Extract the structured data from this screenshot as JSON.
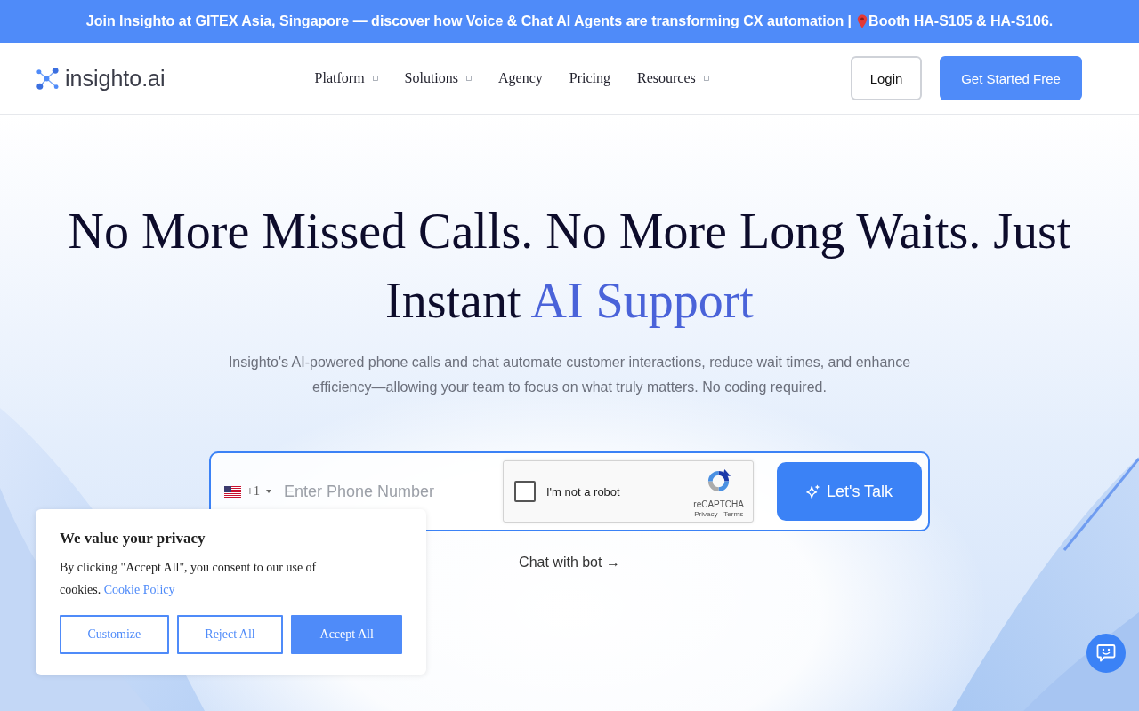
{
  "announcement_bar": {
    "text": "Join Insighto at GITEX Asia, Singapore — discover how Voice & Chat AI Agents are transforming CX automation |",
    "booth": "Booth HA-S105 & HA-S106."
  },
  "navbar": {
    "logo": "insighto.ai",
    "menu": [
      {
        "label": "Platform",
        "dropdown": true
      },
      {
        "label": "Solutions",
        "dropdown": true
      },
      {
        "label": "Agency",
        "dropdown": false
      },
      {
        "label": "Pricing",
        "dropdown": false
      },
      {
        "label": "Resources",
        "dropdown": true
      }
    ],
    "buttons": [
      {
        "label": "Login",
        "kind": "outline"
      },
      {
        "label": "Get Started Free",
        "kind": "primary"
      }
    ]
  },
  "hero": {
    "headline": [
      {
        "text": "No More Missed Calls. No More Long Waits. Just Instant ",
        "kind": "plain"
      },
      {
        "text": "AI Support",
        "kind": "accent"
      }
    ],
    "subtitle": "Insighto's AI-powered phone calls and chat automate customer interactions, reduce wait times, and enhance efficiency—allowing your team to focus on what truly matters. No coding required.",
    "phone_form": {
      "country_code": "+1",
      "placeholder": "Enter Phone Number",
      "captcha": {
        "label": "I'm not a robot",
        "checked": false,
        "brand": "reCAPTCHA",
        "links": "Privacy - Terms"
      },
      "submit": "Let's Talk"
    },
    "chat_link": "Chat with bot →"
  },
  "cookie_banner": {
    "title": "We value your privacy",
    "text": "By clicking \"Accept All\", you consent to our use of cookies.",
    "link": "Cookie Policy",
    "buttons": [
      {
        "label": "Customize",
        "kind": "outline"
      },
      {
        "label": "Reject All",
        "kind": "outline"
      },
      {
        "label": "Accept All",
        "kind": "primary"
      }
    ]
  }
}
